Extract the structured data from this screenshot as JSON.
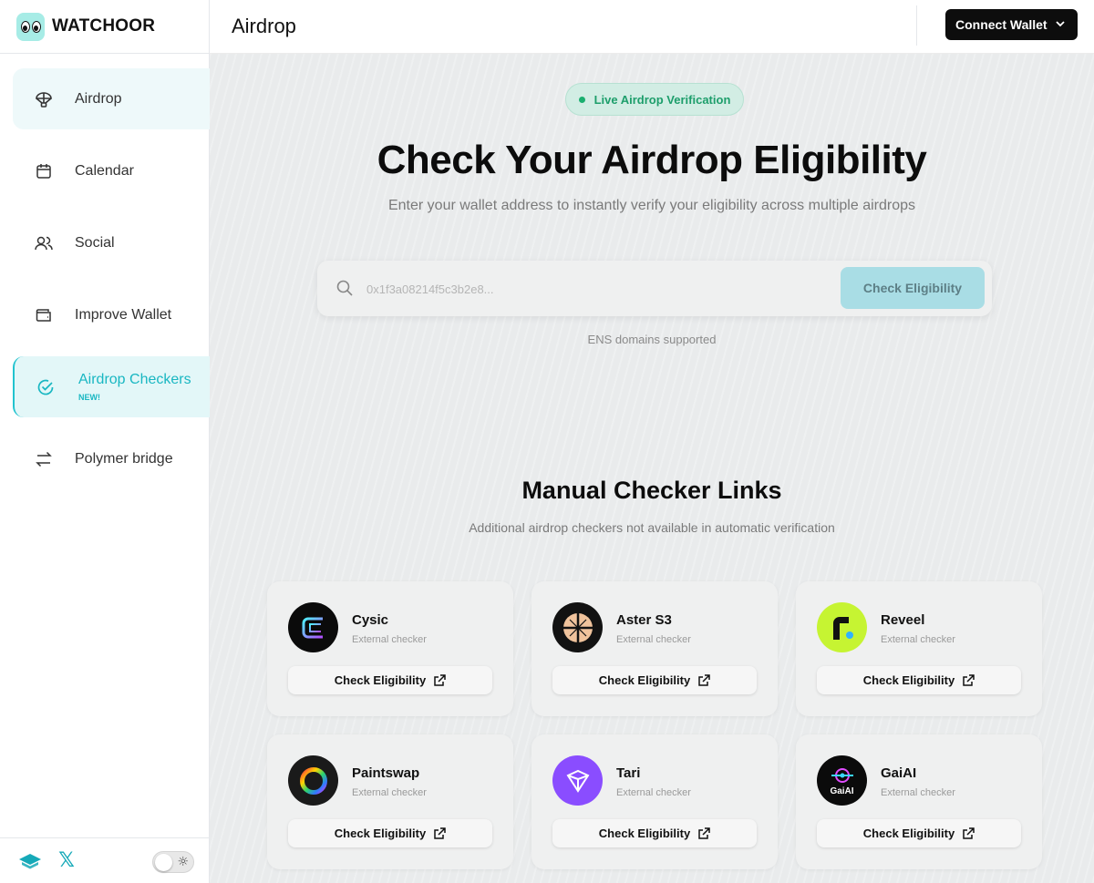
{
  "brand": {
    "name": "WATCHOOR"
  },
  "sidebar": {
    "items": [
      {
        "label": "Airdrop",
        "icon": "parachute-icon"
      },
      {
        "label": "Calendar",
        "icon": "calendar-icon"
      },
      {
        "label": "Social",
        "icon": "users-icon"
      },
      {
        "label": "Improve Wallet",
        "icon": "wallet-icon"
      },
      {
        "label": "Airdrop Checkers",
        "icon": "check-circle-icon",
        "badge": "NEW!"
      },
      {
        "label": "Polymer bridge",
        "icon": "swap-icon"
      }
    ],
    "footer": {
      "icons": [
        "stack-icon",
        "x-icon"
      ],
      "x_glyph": "𝕏",
      "sun_glyph": "☼"
    }
  },
  "header": {
    "title": "Airdrop",
    "connect_label": "Connect Wallet"
  },
  "hero": {
    "badge": "Live Airdrop Verification",
    "title": "Check Your Airdrop Eligibility",
    "subtitle": "Enter your wallet address to instantly verify your eligibility across multiple airdrops",
    "search_placeholder": "0x1f3a08214f5c3b2e8...",
    "check_label": "Check Eligibility",
    "ens_note": "ENS domains supported"
  },
  "manual": {
    "title": "Manual Checker Links",
    "subtitle": "Additional airdrop checkers not available in automatic verification",
    "cards": [
      {
        "name": "Cysic",
        "sub": "External checker",
        "button": "Check Eligibility"
      },
      {
        "name": "Aster S3",
        "sub": "External checker",
        "button": "Check Eligibility"
      },
      {
        "name": "Reveel",
        "sub": "External checker",
        "button": "Check Eligibility"
      },
      {
        "name": "Paintswap",
        "sub": "External checker",
        "button": "Check Eligibility"
      },
      {
        "name": "Tari",
        "sub": "External checker",
        "button": "Check Eligibility"
      },
      {
        "name": "GaiAI",
        "sub": "External checker",
        "button": "Check Eligibility",
        "logo_text": "GaiAI"
      }
    ]
  },
  "colors": {
    "accent": "#19b7c2",
    "live_green": "#1d9e6b",
    "dark": "#0d0d0d"
  }
}
